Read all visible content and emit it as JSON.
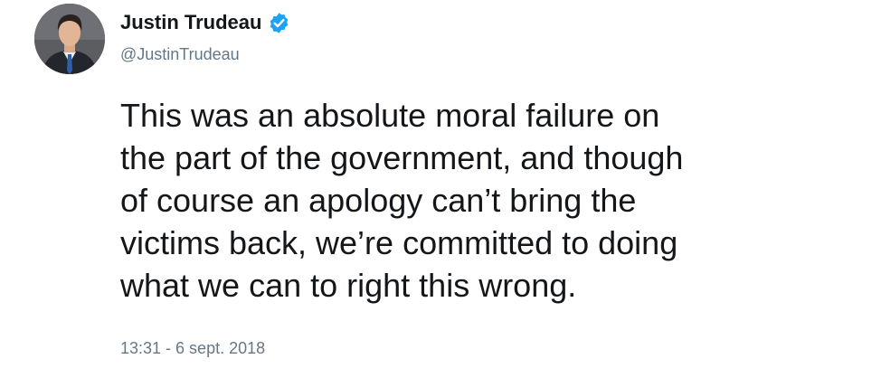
{
  "tweet": {
    "author": {
      "display_name": "Justin Trudeau",
      "handle": "@JustinTrudeau",
      "verified": true,
      "verified_icon": "verified-badge-icon",
      "avatar_icon": "profile-photo-avatar"
    },
    "text_lines": [
      "This was an absolute moral failure on",
      "the part of the government, and though",
      "of course an apology can’t bring the",
      "victims back, we’re committed to doing",
      "what we can to right this wrong."
    ],
    "timestamp": "13:31 - 6 sept. 2018"
  },
  "colors": {
    "text": "#14171a",
    "secondary_text": "#657786",
    "verified_blue": "#1da1f2",
    "background": "#ffffff"
  }
}
